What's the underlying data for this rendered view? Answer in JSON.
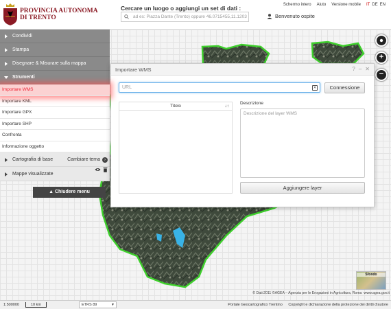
{
  "header": {
    "logo_line1": "PROVINCIA AUTONOMA",
    "logo_line2": "DI TRENTO",
    "search_title": "Cercare un luogo o aggiungi un set di dati :",
    "search_placeholder": "ad es: Piazza Dante (Trento) oppure 46.0715455,11.1203",
    "links": [
      "Schermo intero",
      "Aiuto",
      "Versione mobile"
    ],
    "lang_it": "IT",
    "lang_de": "DE",
    "lang_en": "EN",
    "user": "Benvenuto ospite"
  },
  "sidebar": {
    "sections": [
      "Condividi",
      "Stampa",
      "Disegnare & Misurare sulla mappa"
    ],
    "tools_label": "Strumenti",
    "tools": [
      "Importare WMS",
      "Importare KML",
      "Importare GPX",
      "Importare SHP",
      "Confronta",
      "Informazione oggetto"
    ],
    "basemap_label": "Cartografia di base",
    "basemap_action": "Cambiare tema",
    "layers_label": "Mappe visualizzate",
    "close_menu": "Chiudere menu"
  },
  "dialog": {
    "title": "Importare WMS",
    "url_placeholder": "URL",
    "connect_label": "Connessione",
    "col_title": "Titolo",
    "description_label": "Descrizione",
    "description_placeholder": "Descrizione del layer WMS",
    "add_layer_label": "Aggiungere layer"
  },
  "map": {
    "basemap_thumb_label": "Sfondo",
    "attribution": "© Dati:2011 ©AGEA – Agenzia per le Erogazioni in Agricoltura, Roma -www.agea.gov.it"
  },
  "footer": {
    "scale_text": "1:500000",
    "scale_bar_label": "10 km",
    "crs": "ETRS 89",
    "links": [
      "Portale Geocartografico Trentino",
      "Copyright e dichiarazione della protezione dei diritti d'autore"
    ]
  },
  "colors": {
    "accent_red": "#8b1a24",
    "active_tool": "#e23",
    "map_outline": "#3ecf2c"
  }
}
